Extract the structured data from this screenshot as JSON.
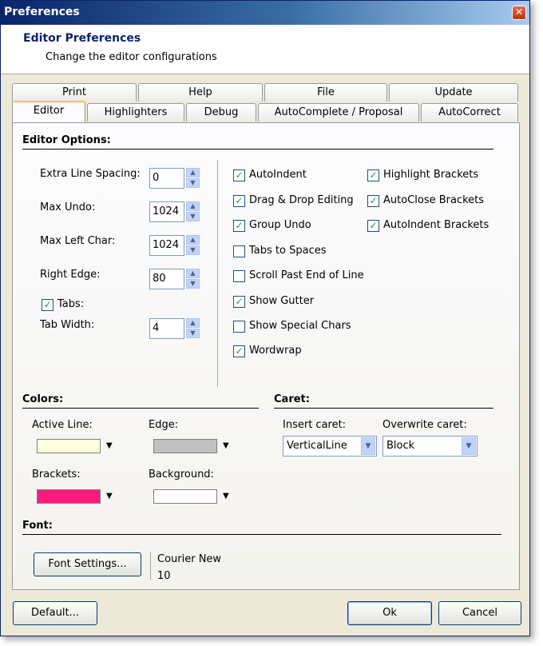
{
  "window": {
    "title": "Preferences"
  },
  "header": {
    "title": "Editor Preferences",
    "subtitle": "Change the editor configurations"
  },
  "tabs_back": [
    "Print",
    "Help",
    "File",
    "Update"
  ],
  "tabs_front": [
    "Editor",
    "Highlighters",
    "Debug",
    "AutoComplete / Proposal",
    "AutoCorrect"
  ],
  "active_tab": "Editor",
  "editor_options": {
    "title": "Editor Options:",
    "extra_line_spacing": {
      "label": "Extra Line Spacing:",
      "value": "0"
    },
    "max_undo": {
      "label": "Max Undo:",
      "value": "1024"
    },
    "max_left_char": {
      "label": "Max Left Char:",
      "value": "1024"
    },
    "right_edge": {
      "label": "Right Edge:",
      "value": "80"
    },
    "tabs": {
      "label": "Tabs:",
      "checked": true
    },
    "tab_width": {
      "label": "Tab Width:",
      "value": "4"
    },
    "checks_left": [
      {
        "label": "AutoIndent",
        "checked": true
      },
      {
        "label": "Drag & Drop Editing",
        "checked": true
      },
      {
        "label": "Group Undo",
        "checked": true
      },
      {
        "label": "Tabs to Spaces",
        "checked": false
      },
      {
        "label": "Scroll Past End of Line",
        "checked": false
      },
      {
        "label": "Show Gutter",
        "checked": true
      },
      {
        "label": "Show Special Chars",
        "checked": false
      },
      {
        "label": "Wordwrap",
        "checked": true
      }
    ],
    "checks_right": [
      {
        "label": "Highlight Brackets",
        "checked": true
      },
      {
        "label": "AutoClose Brackets",
        "checked": true
      },
      {
        "label": "AutoIndent Brackets",
        "checked": true
      }
    ]
  },
  "colors": {
    "title": "Colors:",
    "active_line": {
      "label": "Active Line:",
      "color": "#ffffe0"
    },
    "edge": {
      "label": "Edge:",
      "color": "#c0c0c0"
    },
    "brackets": {
      "label": "Brackets:",
      "color": "#ff1a7f"
    },
    "background": {
      "label": "Background:",
      "color": "#ffffff"
    }
  },
  "caret": {
    "title": "Caret:",
    "insert": {
      "label": "Insert caret:",
      "value": "VerticalLine"
    },
    "overwrite": {
      "label": "Overwrite caret:",
      "value": "Block"
    }
  },
  "font": {
    "title": "Font:",
    "button": "Font Settings...",
    "name": "Courier New",
    "size": "10"
  },
  "buttons": {
    "default": "Default...",
    "ok": "Ok",
    "cancel": "Cancel"
  },
  "icons": {
    "close": "close-icon",
    "spin_up": "spin-up-icon",
    "spin_down": "spin-down-icon",
    "dropdown": "dropdown-arrow-icon",
    "check": "checkmark-icon"
  }
}
